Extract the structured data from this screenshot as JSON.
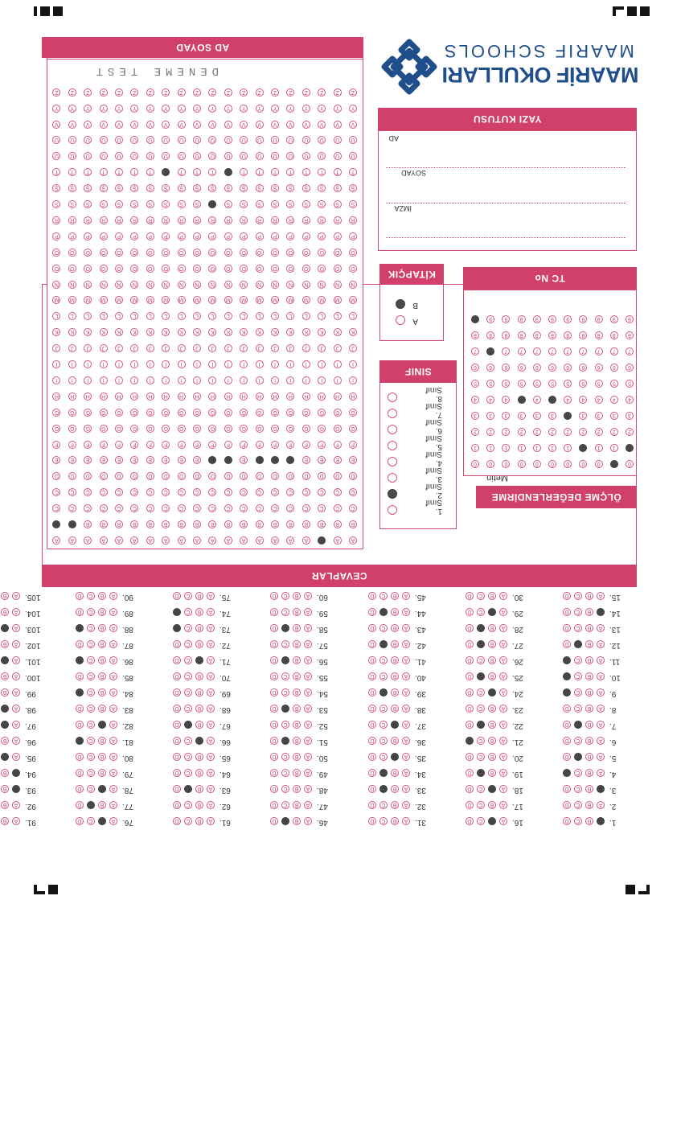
{
  "logo": {
    "title": "MAARİF OKULLARI",
    "subtitle": "MAARIF SCHOOLS"
  },
  "name_box": {
    "title": "AD SOYAD",
    "written_name": "DENEME TEST"
  },
  "alphabet": [
    "A",
    "B",
    "C",
    "Ç",
    "D",
    "E",
    "F",
    "G",
    "Ğ",
    "H",
    "I",
    "İ",
    "J",
    "K",
    "L",
    "M",
    "N",
    "O",
    "Ö",
    "P",
    "R",
    "S",
    "Ş",
    "T",
    "U",
    "Ü",
    "V",
    "Y",
    "Z"
  ],
  "name_fills": [
    [
      2,
      0
    ],
    [
      4,
      5
    ],
    [
      5,
      5
    ],
    [
      6,
      5
    ],
    [
      8,
      5
    ],
    [
      9,
      5
    ],
    [
      18,
      1
    ],
    [
      19,
      1
    ],
    [
      9,
      21
    ],
    [
      12,
      23
    ],
    [
      8,
      23
    ]
  ],
  "writing_box": {
    "title": "YAZI KUTUSU",
    "fields": [
      "AD",
      "SOYAD",
      "İMZA"
    ]
  },
  "tc_box": {
    "title": "TC No",
    "digits": [
      "0",
      "1",
      "2",
      "3",
      "4",
      "5",
      "6",
      "7",
      "8",
      "9"
    ],
    "fills": [
      [
        0,
        1
      ],
      [
        1,
        0
      ],
      [
        3,
        1
      ],
      [
        4,
        3
      ],
      [
        5,
        4
      ],
      [
        7,
        4
      ],
      [
        9,
        7
      ],
      [
        10,
        9
      ]
    ]
  },
  "booklet": {
    "title": "KİTAPÇIK",
    "options": [
      "A",
      "B"
    ],
    "selected": 1
  },
  "grade": {
    "title": "SINIF",
    "options": [
      "1. Sınıf",
      "2. Sınıf",
      "3. Sınıf",
      "4. Sınıf",
      "5. Sınıf",
      "6. Sınıf",
      "7. Sınıf",
      "8. Sınıf"
    ],
    "selected": 1
  },
  "evaluation": {
    "title": "ÖLÇME DEĞERLENDİRME",
    "note": "Metin"
  },
  "answers": {
    "title": "CEVAPLAR",
    "choices": [
      "A",
      "B",
      "C",
      "D"
    ],
    "question_count": 105,
    "marked": {
      "1": 0,
      "3": 0,
      "4": 3,
      "5": 2,
      "7": 2,
      "9": 3,
      "10": 3,
      "11": 3,
      "12": 2,
      "14": 0,
      "16": 1,
      "18": 1,
      "19": 2,
      "21": 3,
      "22": 2,
      "24": 1,
      "25": 2,
      "27": 2,
      "28": 2,
      "29": 1,
      "33": 2,
      "34": 2,
      "35": 1,
      "37": 1,
      "39": 2,
      "42": 2,
      "44": 2,
      "46": 2,
      "51": 2,
      "53": 2,
      "56": 2,
      "58": 2,
      "63": 2,
      "66": 1,
      "67": 2,
      "71": 1,
      "73": 3,
      "74": 3,
      "76": 1,
      "77": 2,
      "78": 1,
      "81": 3,
      "82": 1,
      "84": 3,
      "86": 3,
      "88": 3,
      "91": 3,
      "93": 0,
      "94": 0,
      "95": 1,
      "96": 2,
      "97": 1,
      "98": 1,
      "100": 2,
      "101": 1,
      "102": 2,
      "103": 1,
      "105": 2
    }
  }
}
